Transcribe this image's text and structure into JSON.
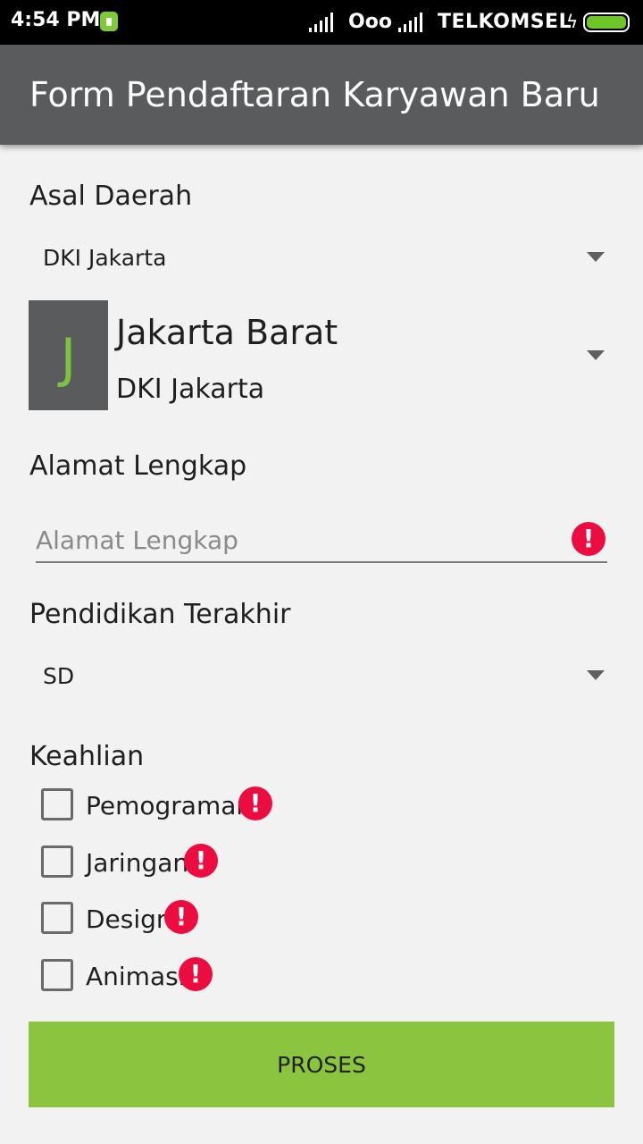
{
  "status_bar": {
    "time": "4:54 PM",
    "network_label": "Ooo",
    "carrier": "TELKOMSEL",
    "charging_symbol": "ϟ",
    "battery_color": "#6ec526"
  },
  "toolbar": {
    "title": "Form Pendaftaran Karyawan Baru",
    "background": "#595b5c"
  },
  "asal_daerah": {
    "label": "Asal Daerah",
    "province_selected": "DKI Jakarta",
    "city_selected": {
      "avatar_letter": "J",
      "name": "Jakarta Barat",
      "province": "DKI Jakarta"
    }
  },
  "alamat": {
    "label": "Alamat Lengkap",
    "value": "",
    "placeholder": "Alamat Lengkap",
    "error_icon": "!"
  },
  "pendidikan": {
    "label": "Pendidikan Terakhir",
    "selected": "SD"
  },
  "keahlian": {
    "label": "Keahlian",
    "options": [
      {
        "label": "Pemograman",
        "checked": false,
        "error": "!"
      },
      {
        "label": "Jaringan",
        "checked": false,
        "error": "!"
      },
      {
        "label": "Design",
        "checked": false,
        "error": "!"
      },
      {
        "label": "Animasi",
        "checked": false,
        "error": "!"
      }
    ]
  },
  "submit": {
    "label": "PROSES",
    "color": "#8bc53f"
  },
  "colors": {
    "error": "#ec0c3f",
    "accent": "#7dc142"
  }
}
